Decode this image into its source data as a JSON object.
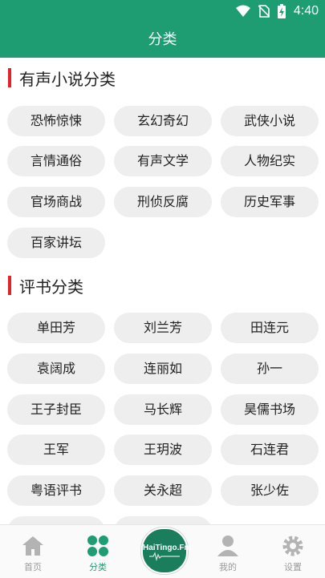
{
  "status_bar": {
    "time": "4:40",
    "icons": [
      "wifi-icon",
      "no-sim-icon",
      "battery-charging-icon"
    ]
  },
  "app_bar": {
    "title": "分类"
  },
  "sections": [
    {
      "title": "有声小说分类",
      "items": [
        "恐怖惊悚",
        "玄幻奇幻",
        "武侠小说",
        "言情通俗",
        "有声文学",
        "人物纪实",
        "官场商战",
        "刑侦反腐",
        "历史军事",
        "百家讲坛"
      ]
    },
    {
      "title": "评书分类",
      "items": [
        "单田芳",
        "刘兰芳",
        "田连元",
        "袁阔成",
        "连丽如",
        "孙一",
        "王子封臣",
        "马长辉",
        "昊儒书场",
        "王军",
        "王玥波",
        "石连君",
        "粤语评书",
        "关永超",
        "张少佐"
      ]
    }
  ],
  "bottom_nav": {
    "items": [
      {
        "label": "首页",
        "icon": "home-icon"
      },
      {
        "label": "分类",
        "icon": "category-grid-icon",
        "active": true
      },
      {
        "label": "HaiTingo.Fm",
        "icon": "player-disc-icon"
      },
      {
        "label": "我的",
        "icon": "person-icon"
      },
      {
        "label": "设置",
        "icon": "gear-icon"
      }
    ]
  },
  "colors": {
    "primary": "#1f9d72",
    "accent_bar": "#e0242a",
    "chip_bg": "#eeeeee",
    "nav_inactive": "#9a9a9a"
  }
}
